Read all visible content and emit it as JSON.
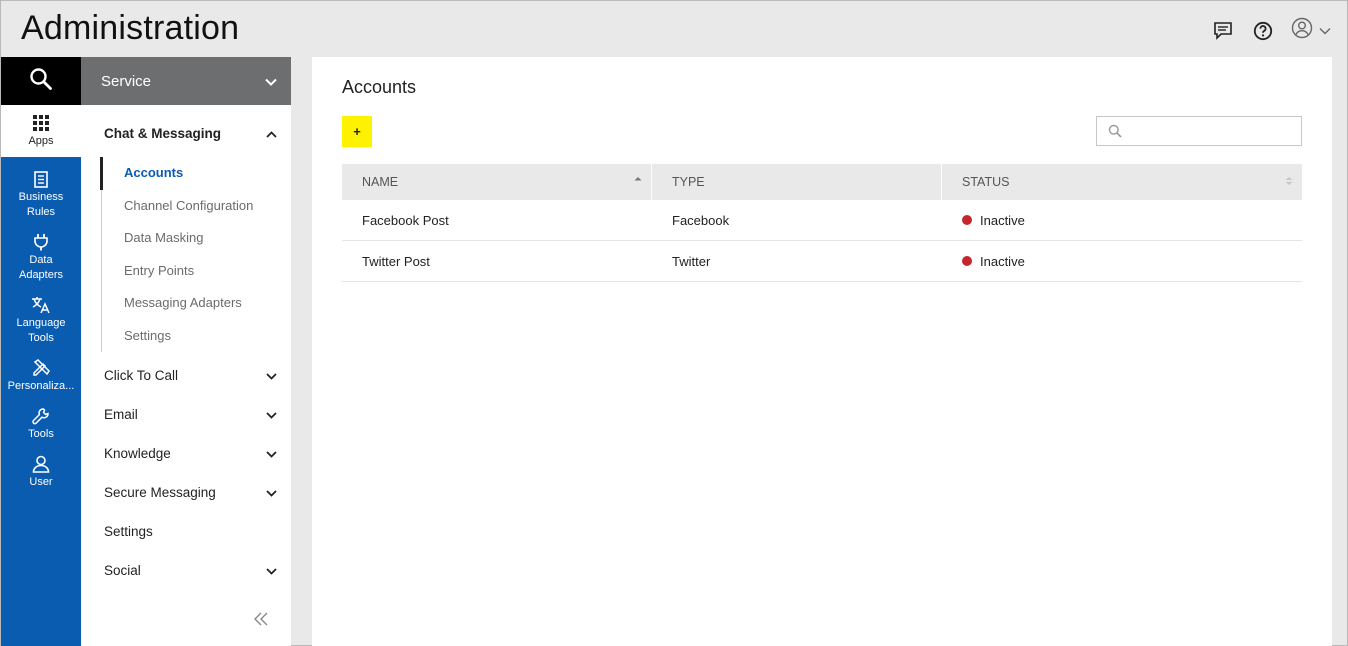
{
  "header": {
    "title": "Administration",
    "icons": [
      "chat-icon",
      "help-icon",
      "user-icon",
      "chevron-down-icon"
    ]
  },
  "rail": {
    "search_icon": "search-icon",
    "items": [
      {
        "label": "Apps",
        "icon": "grid-icon",
        "active": true
      },
      {
        "label": "Business\nRules",
        "icon": "document-icon"
      },
      {
        "label": "Data\nAdapters",
        "icon": "plug-icon"
      },
      {
        "label": "Language\nTools",
        "icon": "translate-icon"
      },
      {
        "label": "Personaliza...",
        "icon": "pencil-ruler-icon"
      },
      {
        "label": "Tools",
        "icon": "wrench-icon"
      },
      {
        "label": "User",
        "icon": "user-icon"
      }
    ]
  },
  "sidenav": {
    "service": "Service",
    "open_group": "Chat & Messaging",
    "sub_items": [
      "Accounts",
      "Channel Configuration",
      "Data Masking",
      "Entry Points",
      "Messaging Adapters",
      "Settings"
    ],
    "groups": [
      {
        "label": "Click To Call",
        "expandable": true
      },
      {
        "label": "Email",
        "expandable": true
      },
      {
        "label": "Knowledge",
        "expandable": true
      },
      {
        "label": "Secure Messaging",
        "expandable": true
      },
      {
        "label": "Settings",
        "expandable": false
      },
      {
        "label": "Social",
        "expandable": true
      }
    ]
  },
  "main": {
    "title": "Accounts",
    "add_label": "+",
    "search_placeholder": "",
    "columns": [
      "NAME",
      "TYPE",
      "STATUS"
    ],
    "rows": [
      {
        "name": "Facebook Post",
        "type": "Facebook",
        "status": "Inactive"
      },
      {
        "name": "Twitter Post",
        "type": "Twitter",
        "status": "Inactive"
      }
    ]
  },
  "colors": {
    "rail_blue": "#0a5cb0",
    "accent_yellow": "#fff200",
    "inactive_red": "#c4262e",
    "active_link": "#0a5cb0"
  }
}
